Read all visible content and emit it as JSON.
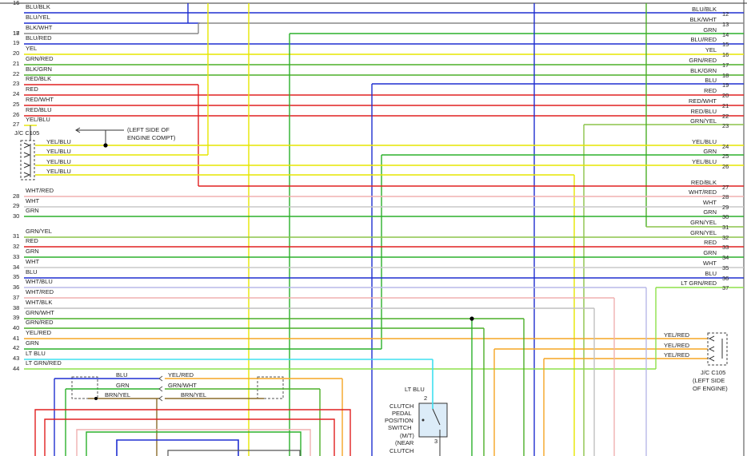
{
  "left_wires": [
    {
      "pin": "16",
      "label": "BLU/BLK",
      "color": "#1f2fd0"
    },
    {
      "pin": "",
      "label": "BLU/YEL",
      "color": "#1f2fd0"
    },
    {
      "pin": "17",
      "label": "BLK/WHT",
      "color": "#888888"
    },
    {
      "pin": "18",
      "label": "",
      "color": "#888888"
    },
    {
      "pin": "19",
      "label": "BLU/RED",
      "color": "#1f2fd0"
    },
    {
      "pin": "20",
      "label": "YEL",
      "color": "#e6e600"
    },
    {
      "pin": "21",
      "label": "GRN/RED",
      "color": "#4caf28"
    },
    {
      "pin": "22",
      "label": "BLK/GRN",
      "color": "#4caf28"
    },
    {
      "pin": "23",
      "label": "RED/BLK",
      "color": "#e02020"
    },
    {
      "pin": "24",
      "label": "RED",
      "color": "#e02020"
    },
    {
      "pin": "25",
      "label": "RED/WHT",
      "color": "#e02020"
    },
    {
      "pin": "26",
      "label": "RED/BLU",
      "color": "#e02020"
    },
    {
      "pin": "27",
      "label": "YEL/BLU",
      "color": "#e6e600"
    },
    {
      "pin": "28",
      "label": "WHT/RED",
      "color": "#f0b0b0"
    },
    {
      "pin": "29",
      "label": "WHT",
      "color": "#c8c8c8"
    },
    {
      "pin": "30",
      "label": "GRN",
      "color": "#2bb02b"
    },
    {
      "pin": "31",
      "label": "GRN/YEL",
      "color": "#8bc34a"
    },
    {
      "pin": "32",
      "label": "RED",
      "color": "#e02020"
    },
    {
      "pin": "33",
      "label": "GRN",
      "color": "#2bb02b"
    },
    {
      "pin": "34",
      "label": "WHT",
      "color": "#c8c8c8"
    },
    {
      "pin": "35",
      "label": "BLU",
      "color": "#1f2fd0"
    },
    {
      "pin": "36",
      "label": "WHT/BLU",
      "color": "#b8b8e8"
    },
    {
      "pin": "37",
      "label": "WHT/RED",
      "color": "#f0b0b0"
    },
    {
      "pin": "38",
      "label": "WHT/BLK",
      "color": "#c0c0c0"
    },
    {
      "pin": "39",
      "label": "GRN/WHT",
      "color": "#4caf28"
    },
    {
      "pin": "40",
      "label": "GRN/RED",
      "color": "#4caf28"
    },
    {
      "pin": "41",
      "label": "YEL/RED",
      "color": "#f5a623"
    },
    {
      "pin": "42",
      "label": "GRN",
      "color": "#2bb02b"
    },
    {
      "pin": "43",
      "label": "LT BLU",
      "color": "#3ee0f0"
    },
    {
      "pin": "44",
      "label": "LT GRN/RED",
      "color": "#8ee04a"
    }
  ],
  "right_wires": [
    {
      "pin": "12",
      "label": "BLU/BLK"
    },
    {
      "pin": "13",
      "label": "BLK/WHT"
    },
    {
      "pin": "14",
      "label": "GRN"
    },
    {
      "pin": "15",
      "label": "BLU/RED"
    },
    {
      "pin": "16",
      "label": "YEL"
    },
    {
      "pin": "17",
      "label": "GRN/RED"
    },
    {
      "pin": "18",
      "label": "BLK/GRN"
    },
    {
      "pin": "19",
      "label": "BLU"
    },
    {
      "pin": "20",
      "label": "RED"
    },
    {
      "pin": "21",
      "label": "RED/WHT"
    },
    {
      "pin": "22",
      "label": "RED/BLU"
    },
    {
      "pin": "23",
      "label": "GRN/YEL"
    },
    {
      "pin": "24",
      "label": "YEL/BLU"
    },
    {
      "pin": "25",
      "label": "GRN"
    },
    {
      "pin": "26",
      "label": "YEL/BLU"
    },
    {
      "pin": "27",
      "label": "RED/BLK"
    },
    {
      "pin": "28",
      "label": "WHT/RED"
    },
    {
      "pin": "29",
      "label": "WHT"
    },
    {
      "pin": "30",
      "label": "GRN"
    },
    {
      "pin": "31",
      "label": "GRN/YEL"
    },
    {
      "pin": "32",
      "label": "GRN/YEL"
    },
    {
      "pin": "33",
      "label": "RED"
    },
    {
      "pin": "34",
      "label": "GRN"
    },
    {
      "pin": "35",
      "label": "WHT"
    },
    {
      "pin": "36",
      "label": "BLU"
    },
    {
      "pin": "37",
      "label": "LT GRN/RED"
    }
  ],
  "jc_left": {
    "title": "J/C C105",
    "note_line1": "(LEFT SIDE OF",
    "note_line2": "ENGINE COMPT)",
    "wire_labels": [
      "YEL/BLU",
      "YEL/BLU",
      "YEL/BLU",
      "YEL/BLU"
    ]
  },
  "jc_right": {
    "title": "J/C C105",
    "note_line1": "(LEFT SIDE",
    "note_line2": "OF ENGINE)",
    "wire_labels": [
      "YEL/RED",
      "YEL/RED",
      "YEL/RED"
    ]
  },
  "switch": {
    "wire_label": "LT BLU",
    "pin_top": "2",
    "pin_bottom": "3",
    "lines": [
      "CLUTCH",
      "PEDAL",
      "POSITION",
      "SWITCH",
      "(M/T)",
      "(NEAR",
      "CLUTCH"
    ]
  },
  "bottom_connectors": {
    "labels_left": [
      "BLU",
      "GRN",
      "BRN/YEL"
    ],
    "labels_right": [
      "YEL/RED",
      "GRN/WHT",
      "BRN/YEL"
    ]
  }
}
